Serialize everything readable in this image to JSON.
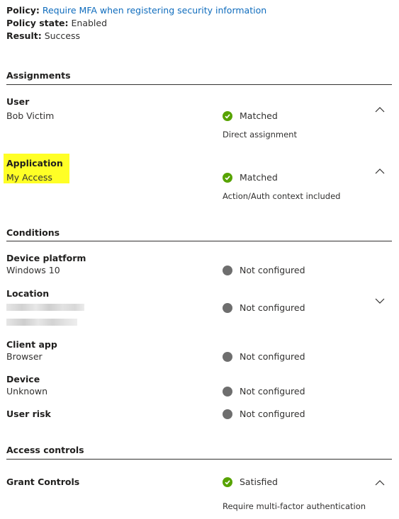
{
  "policy": {
    "policy_label": "Policy:",
    "policy_value": "Require MFA when registering security information",
    "state_label": "Policy state:",
    "state_value": "Enabled",
    "result_label": "Result:",
    "result_value": "Success"
  },
  "assignments": {
    "heading": "Assignments",
    "user": {
      "title": "User",
      "value": "Bob Victim",
      "status": "Matched",
      "detail": "Direct assignment"
    },
    "application": {
      "title": "Application",
      "value": "My Access",
      "status": "Matched",
      "detail": "Action/Auth context included"
    }
  },
  "conditions": {
    "heading": "Conditions",
    "device_platform": {
      "title": "Device platform",
      "value": "Windows 10",
      "status": "Not configured"
    },
    "location": {
      "title": "Location",
      "status": "Not configured"
    },
    "client_app": {
      "title": "Client app",
      "value": "Browser",
      "status": "Not configured"
    },
    "device": {
      "title": "Device",
      "value": "Unknown",
      "status": "Not configured"
    },
    "user_risk": {
      "title": "User risk",
      "status": "Not configured"
    }
  },
  "access_controls": {
    "heading": "Access controls",
    "grant": {
      "title": "Grant Controls",
      "status": "Satisfied",
      "detail": "Require multi-factor authentication"
    }
  },
  "colors": {
    "link": "#0f6cbd",
    "success": "#57a300",
    "neutral": "#6e6e6e",
    "highlight": "#ffff26"
  }
}
